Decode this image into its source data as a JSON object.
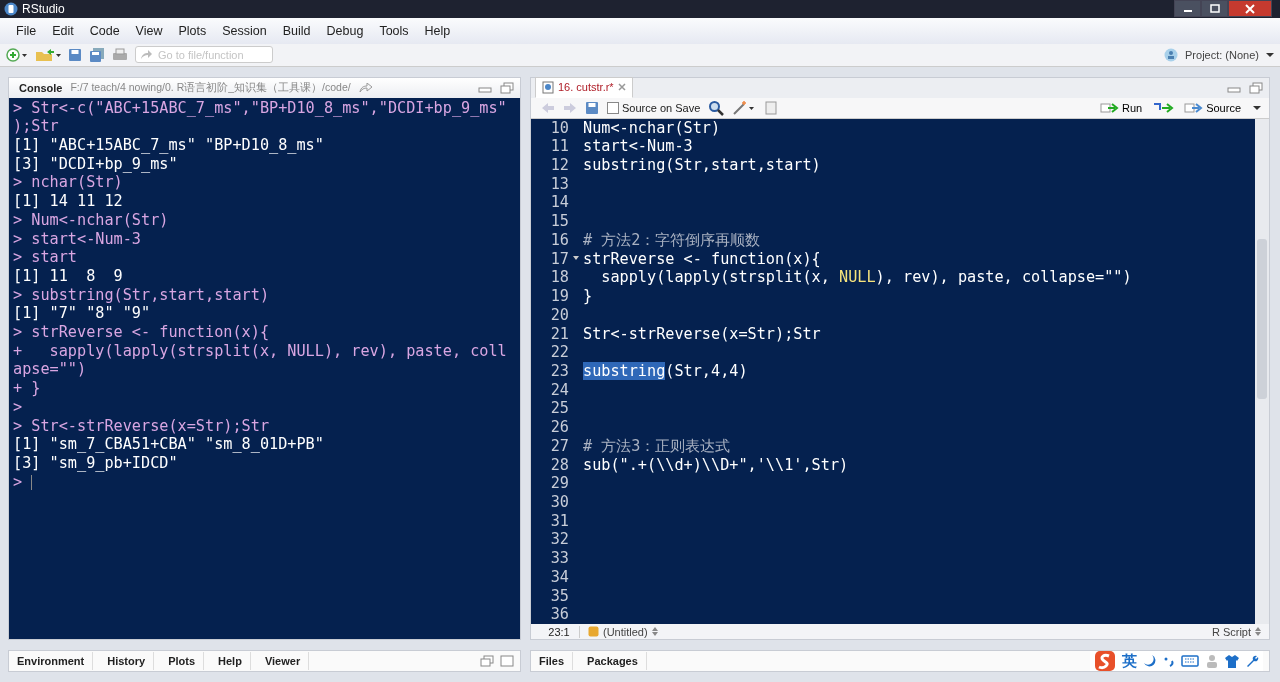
{
  "window": {
    "title": "RStudio"
  },
  "menu": [
    "File",
    "Edit",
    "Code",
    "View",
    "Plots",
    "Session",
    "Build",
    "Debug",
    "Tools",
    "Help"
  ],
  "toolbar": {
    "goto_placeholder": "Go to file/function",
    "project": "Project: (None)"
  },
  "console": {
    "title": "Console",
    "path": "F:/7 teach/4 nowing/0. R语言初阶_知识集（工具课）/code/",
    "lines": [
      {
        "kind": "input",
        "text": "> Str<-c(\"ABC+15ABC_7_ms\",\"BP+D10_8_ms\",\"DCDI+bp_9_ms\""
      },
      {
        "kind": "input",
        "text": ");Str"
      },
      {
        "kind": "output",
        "text": "[1] \"ABC+15ABC_7_ms\" \"BP+D10_8_ms\""
      },
      {
        "kind": "output",
        "text": "[3] \"DCDI+bp_9_ms\""
      },
      {
        "kind": "input",
        "text": "> nchar(Str)"
      },
      {
        "kind": "output",
        "text": "[1] 14 11 12"
      },
      {
        "kind": "input",
        "text": "> Num<-nchar(Str)"
      },
      {
        "kind": "input",
        "text": "> start<-Num-3"
      },
      {
        "kind": "input",
        "text": "> start"
      },
      {
        "kind": "output",
        "text": "[1] 11  8  9"
      },
      {
        "kind": "input",
        "text": "> substring(Str,start,start)"
      },
      {
        "kind": "output",
        "text": "[1] \"7\" \"8\" \"9\""
      },
      {
        "kind": "input",
        "text": "> strReverse <- function(x){"
      },
      {
        "kind": "input",
        "text": "+   sapply(lapply(strsplit(x, NULL), rev), paste, coll"
      },
      {
        "kind": "input",
        "text": "apse=\"\")"
      },
      {
        "kind": "input",
        "text": "+ }"
      },
      {
        "kind": "input",
        "text": ">"
      },
      {
        "kind": "input",
        "text": "> Str<-strReverse(x=Str);Str"
      },
      {
        "kind": "output",
        "text": "[1] \"sm_7_CBA51+CBA\" \"sm_8_01D+PB\""
      },
      {
        "kind": "output",
        "text": "[3] \"sm_9_pb+IDCD\""
      },
      {
        "kind": "prompt",
        "text": ">"
      }
    ]
  },
  "editor": {
    "tab": {
      "label": "16. cutstr.r*",
      "selected": true
    },
    "source_on_save": {
      "label": "Source on Save",
      "checked": false
    },
    "run": "Run",
    "source": "Source",
    "lines": [
      {
        "n": "10",
        "parts": [
          {
            "kind": "code",
            "text": "Num<-nchar(Str)"
          }
        ]
      },
      {
        "n": "11",
        "parts": [
          {
            "kind": "code",
            "text": "start<-Num-3"
          }
        ]
      },
      {
        "n": "12",
        "parts": [
          {
            "kind": "code",
            "text": "substring(Str,start,start)"
          }
        ]
      },
      {
        "n": "13"
      },
      {
        "n": "14"
      },
      {
        "n": "15"
      },
      {
        "n": "16",
        "parts": [
          {
            "kind": "comment",
            "text": "# 方法2：字符倒序再顺数"
          }
        ]
      },
      {
        "n": "17",
        "fold": true,
        "parts": [
          {
            "kind": "code",
            "text": "strReverse <- function(x){"
          }
        ]
      },
      {
        "n": "18",
        "parts": [
          {
            "kind": "code",
            "text": "  sapply(lapply(strsplit(x, "
          },
          {
            "kind": "constant",
            "text": "NULL"
          },
          {
            "kind": "code",
            "text": "), rev), paste, collapse=\"\")"
          }
        ]
      },
      {
        "n": "19",
        "parts": [
          {
            "kind": "code",
            "text": "}"
          }
        ]
      },
      {
        "n": "20"
      },
      {
        "n": "21",
        "parts": [
          {
            "kind": "code",
            "text": "Str<-strReverse(x=Str);Str"
          }
        ]
      },
      {
        "n": "22"
      },
      {
        "n": "23",
        "parts": [
          {
            "kind": "selected",
            "text": "substring"
          },
          {
            "kind": "code",
            "text": "(Str,4,4)"
          }
        ]
      },
      {
        "n": "24"
      },
      {
        "n": "25"
      },
      {
        "n": "26"
      },
      {
        "n": "27",
        "parts": [
          {
            "kind": "comment",
            "text": "# 方法3：正则表达式"
          }
        ]
      },
      {
        "n": "28",
        "parts": [
          {
            "kind": "code",
            "text": "sub(\".+(\\\\d+)\\\\D+\",'\\\\1',Str)"
          }
        ]
      },
      {
        "n": "29"
      },
      {
        "n": "30"
      },
      {
        "n": "31"
      },
      {
        "n": "32"
      },
      {
        "n": "33"
      },
      {
        "n": "34"
      },
      {
        "n": "35"
      },
      {
        "n": "36"
      }
    ],
    "status": {
      "position": "23:1",
      "scope": "(Untitled)",
      "type": "R Script"
    }
  },
  "bottom_left_tabs": [
    "Environment",
    "History",
    "Plots",
    "Help",
    "Viewer"
  ],
  "bottom_right_tabs": [
    "Files",
    "Packages"
  ],
  "ime": {
    "mode": "英"
  }
}
